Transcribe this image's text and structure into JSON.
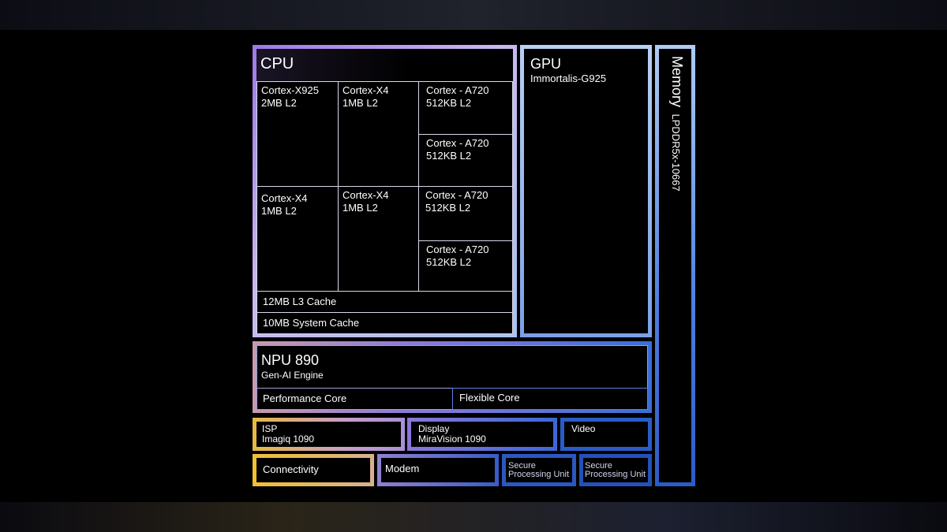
{
  "cpu": {
    "title": "CPU",
    "cores": [
      {
        "name": "Cortex-X925",
        "cache": "2MB L2"
      },
      {
        "name": "Cortex-X4",
        "cache": "1MB L2"
      },
      {
        "name": "Cortex - A720",
        "cache": "512KB L2"
      },
      {
        "name": "Cortex - A720",
        "cache": "512KB L2"
      },
      {
        "name": "Cortex-X4",
        "cache": "1MB L2"
      },
      {
        "name": "Cortex-X4",
        "cache": "1MB L2"
      },
      {
        "name": "Cortex - A720",
        "cache": "512KB L2"
      },
      {
        "name": "Cortex - A720",
        "cache": "512KB L2"
      }
    ],
    "l3": "12MB L3 Cache",
    "system_cache": "10MB System Cache"
  },
  "gpu": {
    "title": "GPU",
    "name": "Immortalis-G925"
  },
  "memory": {
    "title": "Memory",
    "type": "LPDDR5x-10667"
  },
  "npu": {
    "title": "NPU 890",
    "subtitle": "Gen-AI Engine",
    "performance": "Performance Core",
    "flexible": "Flexible Core"
  },
  "isp": {
    "title": "ISP",
    "name": "Imagiq 1090"
  },
  "display": {
    "title": "Display",
    "name": "MiraVision 1090"
  },
  "video": {
    "title": "Video"
  },
  "connectivity": "Connectivity",
  "modem": "Modem",
  "secure": [
    {
      "line1": "Secure",
      "line2": "Processing Unit"
    },
    {
      "line1": "Secure",
      "line2": "Processing Unit"
    }
  ]
}
